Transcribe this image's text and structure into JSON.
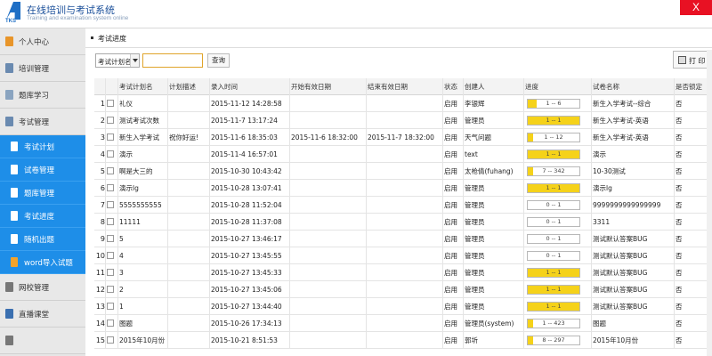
{
  "header": {
    "title": "在线培训与考试系统",
    "subtitle": "Training and examination system online",
    "logo_text": "TKS",
    "close_label": "X"
  },
  "sidebar": {
    "items": [
      {
        "label": "个人中心",
        "icon": "person-icon"
      },
      {
        "label": "培训管理",
        "icon": "training-icon"
      },
      {
        "label": "题库学习",
        "icon": "question-bank-icon"
      },
      {
        "label": "考试管理",
        "icon": "exam-icon"
      }
    ],
    "sub_items": [
      {
        "label": "考试计划",
        "icon": "document-icon"
      },
      {
        "label": "试卷管理",
        "icon": "document-icon"
      },
      {
        "label": "题库管理",
        "icon": "document-icon"
      },
      {
        "label": "考试进度",
        "icon": "document-icon"
      },
      {
        "label": "随机出题",
        "icon": "document-icon"
      },
      {
        "label": "word导入试题",
        "icon": "word-icon"
      }
    ],
    "bottom_items": [
      {
        "label": "网校管理",
        "icon": "pencil-icon"
      },
      {
        "label": "直播课堂",
        "icon": "video-icon"
      },
      {
        "label": "",
        "icon": "settings-icon"
      }
    ]
  },
  "breadcrumb": "考试进度",
  "toolbar": {
    "filter_value": "考试计划名",
    "search_value": "",
    "query_label": "查询",
    "print_label": "打 印"
  },
  "columns": [
    "考试计划名",
    "计划描述",
    "录入时间",
    "开始有效日期",
    "结束有效日期",
    "状态",
    "创建人",
    "进度",
    "试卷名称",
    "是否锁定"
  ],
  "rows": [
    {
      "n": "1",
      "name": "礼仪",
      "desc": "",
      "time": "2015-11-12 14:28:58",
      "start": "",
      "end": "",
      "status": "启用",
      "creator": "李银辉",
      "prog": "1 -- 6",
      "pct": 0.17,
      "paper": "新生入学考试--综合",
      "lock": "否"
    },
    {
      "n": "2",
      "name": "测试考试次数",
      "desc": "",
      "time": "2015-11-7 13:17:24",
      "start": "",
      "end": "",
      "status": "启用",
      "creator": "管理员",
      "prog": "1 -- 1",
      "pct": 1,
      "paper": "新生入学考试-英语",
      "lock": "否"
    },
    {
      "n": "3",
      "name": "新生入学考试",
      "desc": "祝你好运!",
      "time": "2015-11-6 18:35:03",
      "start": "2015-11-6 18:32:00",
      "end": "2015-11-7 18:32:00",
      "status": "启用",
      "creator": "天气问题",
      "prog": "1 -- 12",
      "pct": 0.08,
      "paper": "新生入学考试-英语",
      "lock": "否"
    },
    {
      "n": "4",
      "name": "演示",
      "desc": "",
      "time": "2015-11-4 16:57:01",
      "start": "",
      "end": "",
      "status": "启用",
      "creator": "text",
      "prog": "1 -- 1",
      "pct": 1,
      "paper": "演示",
      "lock": "否"
    },
    {
      "n": "5",
      "name": "啊是大三的",
      "desc": "",
      "time": "2015-10-30 10:43:42",
      "start": "",
      "end": "",
      "status": "启用",
      "creator": "太枪倩(fuhang)",
      "prog": "7 -- 342",
      "pct": 0.02,
      "paper": "10-30测试",
      "lock": "否"
    },
    {
      "n": "6",
      "name": "演示lg",
      "desc": "",
      "time": "2015-10-28 13:07:41",
      "start": "",
      "end": "",
      "status": "启用",
      "creator": "管理员",
      "prog": "1 -- 1",
      "pct": 1,
      "paper": "演示lg",
      "lock": "否"
    },
    {
      "n": "7",
      "name": "5555555555",
      "desc": "",
      "time": "2015-10-28 11:52:04",
      "start": "",
      "end": "",
      "status": "启用",
      "creator": "管理员",
      "prog": "0 -- 1",
      "pct": 0,
      "paper": "9999999999999999",
      "lock": "否"
    },
    {
      "n": "8",
      "name": "11111",
      "desc": "",
      "time": "2015-10-28 11:37:08",
      "start": "",
      "end": "",
      "status": "启用",
      "creator": "管理员",
      "prog": "0 -- 1",
      "pct": 0,
      "paper": "3311",
      "lock": "否"
    },
    {
      "n": "9",
      "name": "5",
      "desc": "",
      "time": "2015-10-27 13:46:17",
      "start": "",
      "end": "",
      "status": "启用",
      "creator": "管理员",
      "prog": "0 -- 1",
      "pct": 0,
      "paper": "测试默认答案BUG",
      "lock": "否"
    },
    {
      "n": "10",
      "name": "4",
      "desc": "",
      "time": "2015-10-27 13:45:55",
      "start": "",
      "end": "",
      "status": "启用",
      "creator": "管理员",
      "prog": "0 -- 1",
      "pct": 0,
      "paper": "测试默认答案BUG",
      "lock": "否"
    },
    {
      "n": "11",
      "name": "3",
      "desc": "",
      "time": "2015-10-27 13:45:33",
      "start": "",
      "end": "",
      "status": "启用",
      "creator": "管理员",
      "prog": "1 -- 1",
      "pct": 1,
      "paper": "测试默认答案BUG",
      "lock": "否"
    },
    {
      "n": "12",
      "name": "2",
      "desc": "",
      "time": "2015-10-27 13:45:06",
      "start": "",
      "end": "",
      "status": "启用",
      "creator": "管理员",
      "prog": "1 -- 1",
      "pct": 1,
      "paper": "测试默认答案BUG",
      "lock": "否"
    },
    {
      "n": "13",
      "name": "1",
      "desc": "",
      "time": "2015-10-27 13:44:40",
      "start": "",
      "end": "",
      "status": "启用",
      "creator": "管理员",
      "prog": "1 -- 1",
      "pct": 1,
      "paper": "测试默认答案BUG",
      "lock": "否"
    },
    {
      "n": "14",
      "name": "图题",
      "desc": "",
      "time": "2015-10-26 17:34:13",
      "start": "",
      "end": "",
      "status": "启用",
      "creator": "管理员(system)",
      "prog": "1 -- 423",
      "pct": 0.005,
      "paper": "图题",
      "lock": "否"
    },
    {
      "n": "15",
      "name": "2015年10月份",
      "desc": "",
      "time": "2015-10-21 8:51:53",
      "start": "",
      "end": "",
      "status": "启用",
      "creator": "郭圻",
      "prog": "8 -- 297",
      "pct": 0.03,
      "paper": "2015年10月份",
      "lock": "否"
    }
  ],
  "colors": {
    "accent": "#1e8ee8",
    "progress_fill": "#f5d21a",
    "close": "#e81123"
  }
}
